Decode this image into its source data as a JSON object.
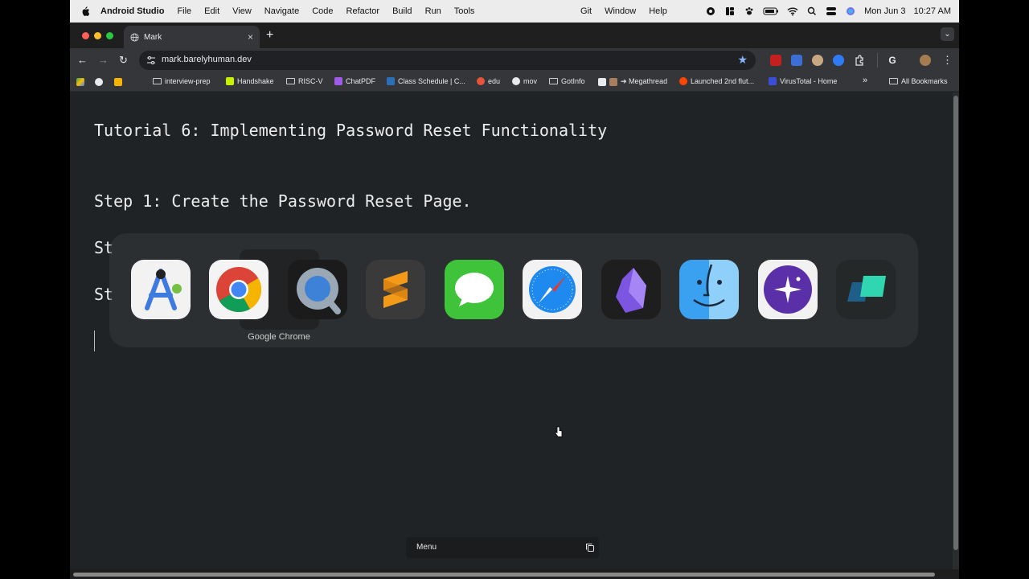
{
  "menubar": {
    "app_name": "Android Studio",
    "items": [
      "File",
      "Edit",
      "View",
      "Navigate",
      "Code",
      "Refactor",
      "Build",
      "Run",
      "Tools"
    ],
    "items_right": [
      "Git",
      "Window",
      "Help"
    ],
    "date": "Mon Jun 3",
    "time": "10:27 AM"
  },
  "browser": {
    "tab_title": "Mark",
    "url": "mark.barelyhuman.dev",
    "bookmarks": [
      {
        "label": "interview-prep",
        "icon": "folder-icon"
      },
      {
        "label": "Handshake",
        "icon": "handshake-icon"
      },
      {
        "label": "RISC-V",
        "icon": "folder-icon"
      },
      {
        "label": "ChatPDF",
        "icon": "chatpdf-icon"
      },
      {
        "label": "Class Schedule | C...",
        "icon": "class-schedule-icon"
      },
      {
        "label": "edu",
        "icon": "edu-icon"
      },
      {
        "label": "mov",
        "icon": "mov-icon"
      },
      {
        "label": "GotInfo",
        "icon": "folder-icon"
      },
      {
        "label": "➔ Megathread",
        "icon": "megathread-icon"
      },
      {
        "label": "Launched 2nd flut...",
        "icon": "reddit-icon"
      },
      {
        "label": "VirusTotal - Home",
        "icon": "virustotal-icon"
      }
    ],
    "all_bookmarks": "All Bookmarks",
    "more": "»"
  },
  "page": {
    "title": "Tutorial 6: Implementing Password Reset Functionality",
    "step1": "Step 1: Create the Password Reset Page.",
    "step2_partial": "St",
    "step3_partial": "St"
  },
  "switcher": {
    "selected_app": "Google Chrome",
    "apps": [
      "Android Studio",
      "Google Chrome",
      "QuickTime Player",
      "Sublime Text",
      "Messages",
      "Safari",
      "Obsidian",
      "Finder",
      "Raycast",
      "Vectorize"
    ]
  },
  "bottom_menu": {
    "label": "Menu"
  },
  "colors": {
    "page_bg": "#202325",
    "text": "#ececec",
    "toolbar": "#35363a",
    "accent_star": "#8ab4f8"
  }
}
